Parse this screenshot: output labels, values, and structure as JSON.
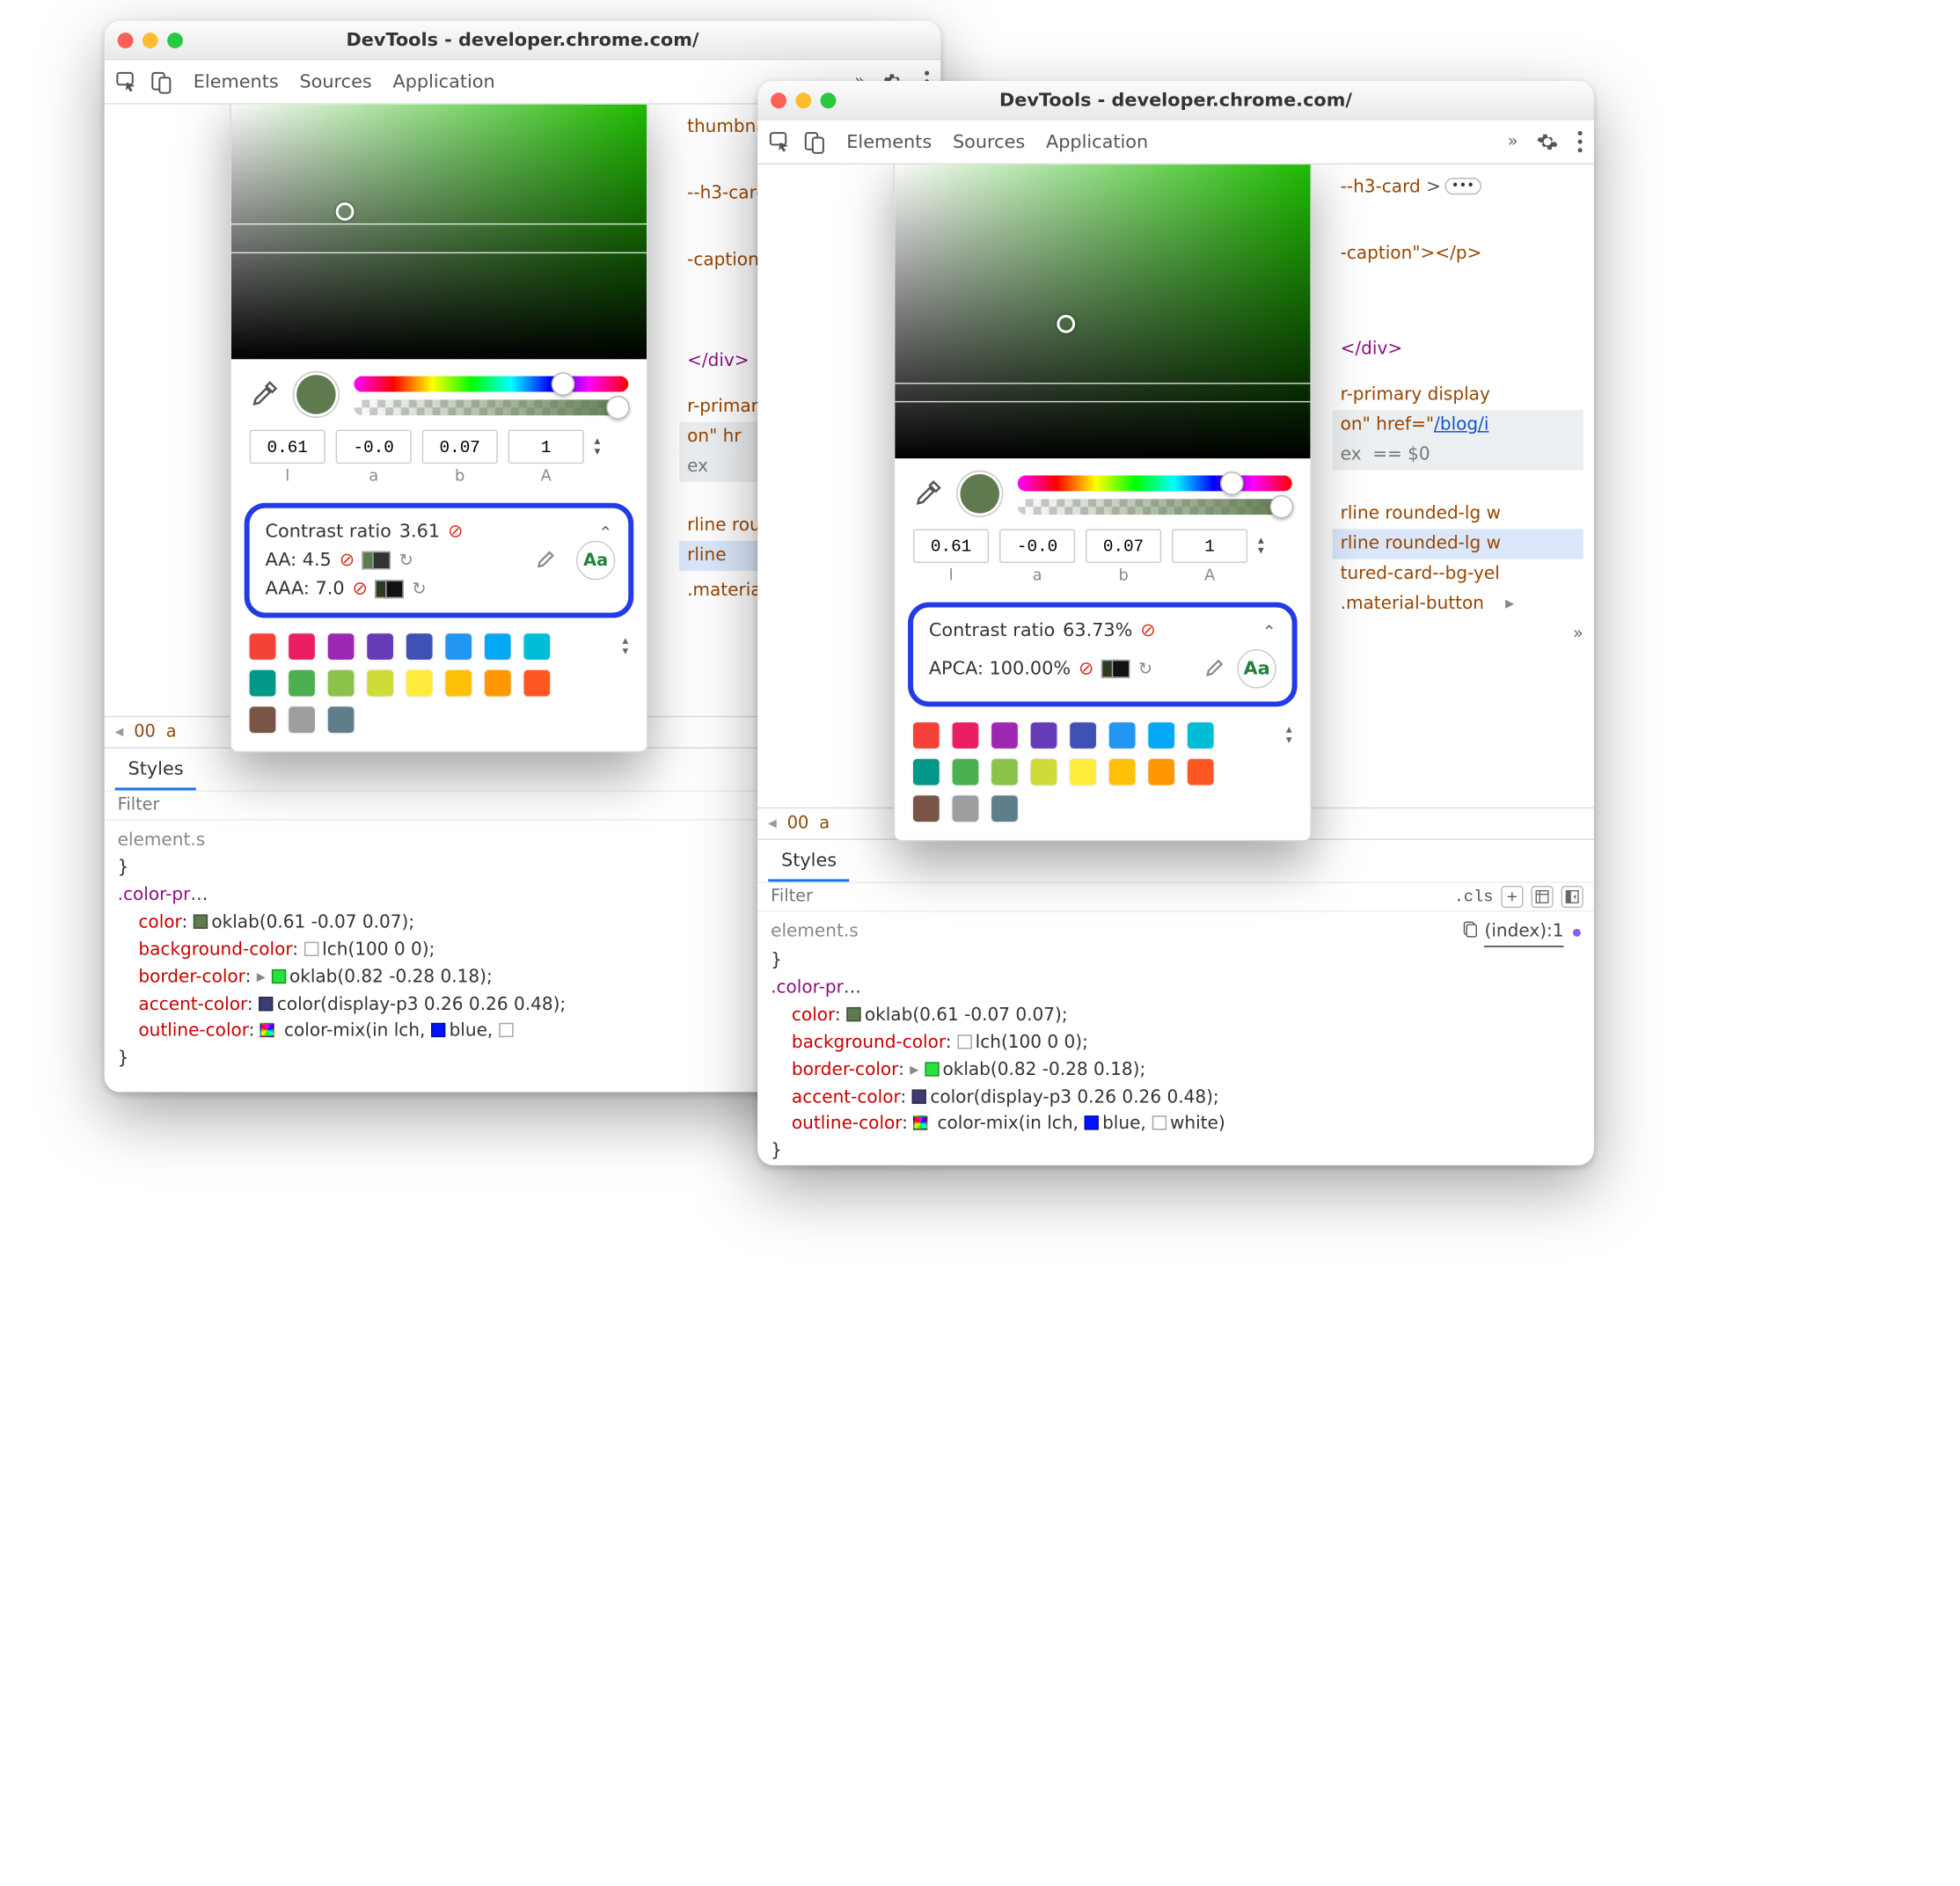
{
  "common": {
    "title": "DevTools - developer.chrome.com/",
    "tabs": [
      "Elements",
      "Sources",
      "Application"
    ],
    "styles_tab": "Styles",
    "filter_placeholder": "Filter",
    "cls": ".cls",
    "element_style": "element.s",
    "dom": {
      "thumbnail_fragment": "thumbna",
      "h3_fragment": "--h3-card",
      "caption_fragment": "-caption\"></p>",
      "div_close": "</div>",
      "primary_fragment_l": "r-primar…",
      "primary_fragment_r": "r-primary display",
      "onhref_l": "on\" hr",
      "onhref_r": "on\" href=\"",
      "blog_path": "/blog/i",
      "ex_eq": "ex  == $0",
      "rounded_fragment": "rline rounded-lg w",
      "featured_fragment": "tured-card--bg-yel",
      "material_fragment": ".material-button",
      "index_label": "(index):1"
    },
    "breadcrumb": {
      "first": "00",
      "second": "a"
    },
    "picker": {
      "values": {
        "l": "0.61",
        "a": "-0.0",
        "b": "0.07",
        "alpha": "1"
      },
      "labels": {
        "l": "l",
        "a": "a",
        "b": "b",
        "alpha": "A"
      },
      "current_color": "#5f7a4f",
      "palette": [
        [
          "#f44336",
          "#e91e63",
          "#9c27b0",
          "#673ab7",
          "#3f51b5",
          "#2196f3",
          "#03a9f4",
          "#00bcd4"
        ],
        [
          "#009688",
          "#4caf50",
          "#8bc34a",
          "#cddc39",
          "#ffeb3b",
          "#ffc107",
          "#ff9800",
          "#ff5722"
        ],
        [
          "#795548",
          "#9e9e9e",
          "#607d8b"
        ]
      ]
    },
    "css": {
      "rule_sel": ".color-pr",
      "props": {
        "color": "oklab(0.61 -0.07 0.07);",
        "bg": "lch(100 0 0);",
        "border": "oklab(0.82 -0.28 0.18);",
        "accent": "color(display-p3 0.26 0.26 0.48);",
        "outline": "color-mix(in lch, ",
        "outline_blue": "blue",
        "outline_white": "white"
      },
      "swatches": {
        "color": "#5f7a4f",
        "bg": "#ffffff",
        "border": "#27e23a",
        "accent": "#3c3c73",
        "mix": "conic",
        "blue": "#0013ff",
        "white": "#ffffff"
      }
    }
  },
  "left": {
    "contrast": {
      "label": "Contrast ratio",
      "value": "3.61",
      "aa_label": "AA: 4.5",
      "aaa_label": "AAA: 7.0"
    }
  },
  "right": {
    "contrast": {
      "label": "Contrast ratio",
      "value": "63.73%",
      "apca_label": "APCA: 100.00%"
    }
  }
}
